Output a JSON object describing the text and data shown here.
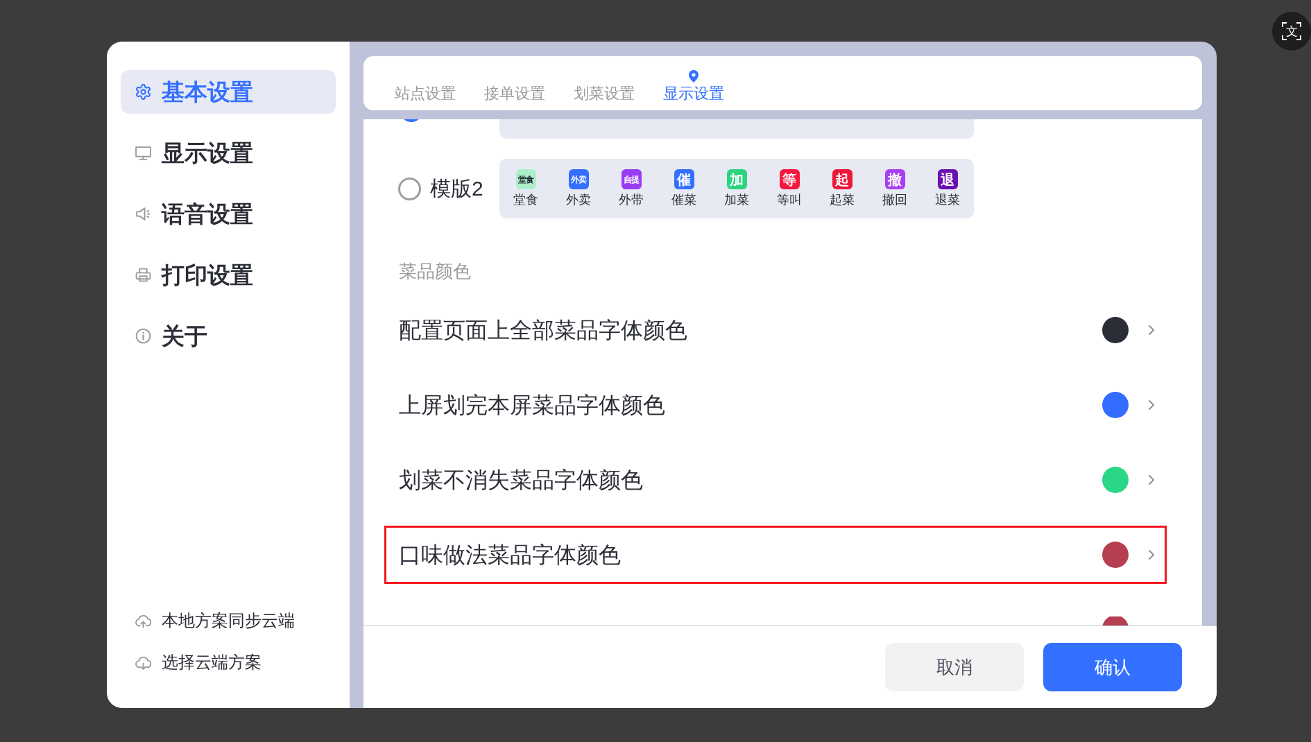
{
  "sidebar": {
    "items": [
      {
        "label": "基本设置",
        "selected": true
      },
      {
        "label": "显示设置",
        "selected": false
      },
      {
        "label": "语音设置",
        "selected": false
      },
      {
        "label": "打印设置",
        "selected": false
      },
      {
        "label": "关于",
        "selected": false
      }
    ],
    "actions": [
      {
        "label": "本地方案同步云端"
      },
      {
        "label": "选择云端方案"
      }
    ]
  },
  "tabs": [
    {
      "label": "站点设置",
      "selected": false
    },
    {
      "label": "接单设置",
      "selected": false
    },
    {
      "label": "划菜设置",
      "selected": false
    },
    {
      "label": "显示设置",
      "selected": true
    }
  ],
  "templates": [
    {
      "kind": "partial",
      "selected": true
    },
    {
      "kind": "full",
      "label": "模版2",
      "selected": false,
      "badges": [
        {
          "text": "堂食",
          "label": "堂食",
          "color": "#aeeecb"
        },
        {
          "text": "外卖",
          "label": "外卖",
          "color": "#3370ff"
        },
        {
          "text": "自提",
          "label": "外带",
          "color": "#9a3cf5"
        },
        {
          "text": "催",
          "label": "催菜",
          "color": "#3370ff"
        },
        {
          "text": "加",
          "label": "加菜",
          "color": "#2cd47f"
        },
        {
          "text": "等",
          "label": "等叫",
          "color": "#f5173c"
        },
        {
          "text": "起",
          "label": "起菜",
          "color": "#ee1638"
        },
        {
          "text": "撤",
          "label": "撤回",
          "color": "#a640f2"
        },
        {
          "text": "退",
          "label": "退菜",
          "color": "#6a0fb0"
        }
      ]
    }
  ],
  "section_title": "菜品颜色",
  "color_rows": [
    {
      "kind": "full",
      "label": "配置页面上全部菜品字体颜色",
      "color": "#2b2e36",
      "highlighted": false
    },
    {
      "kind": "full",
      "label": "上屏划完本屏菜品字体颜色",
      "color": "#336dff",
      "highlighted": false
    },
    {
      "kind": "full",
      "label": "划菜不消失菜品字体颜色",
      "color": "#2bd686",
      "highlighted": false
    },
    {
      "kind": "full",
      "label": "口味做法菜品字体颜色",
      "color": "#b53f50",
      "highlighted": true
    },
    {
      "kind": "partial",
      "color": "#b53f50"
    }
  ],
  "buttons": [
    {
      "label": "取消",
      "kind": "secondary"
    },
    {
      "label": "确认",
      "kind": "primary"
    }
  ],
  "translate_button": {
    "label": "文"
  }
}
